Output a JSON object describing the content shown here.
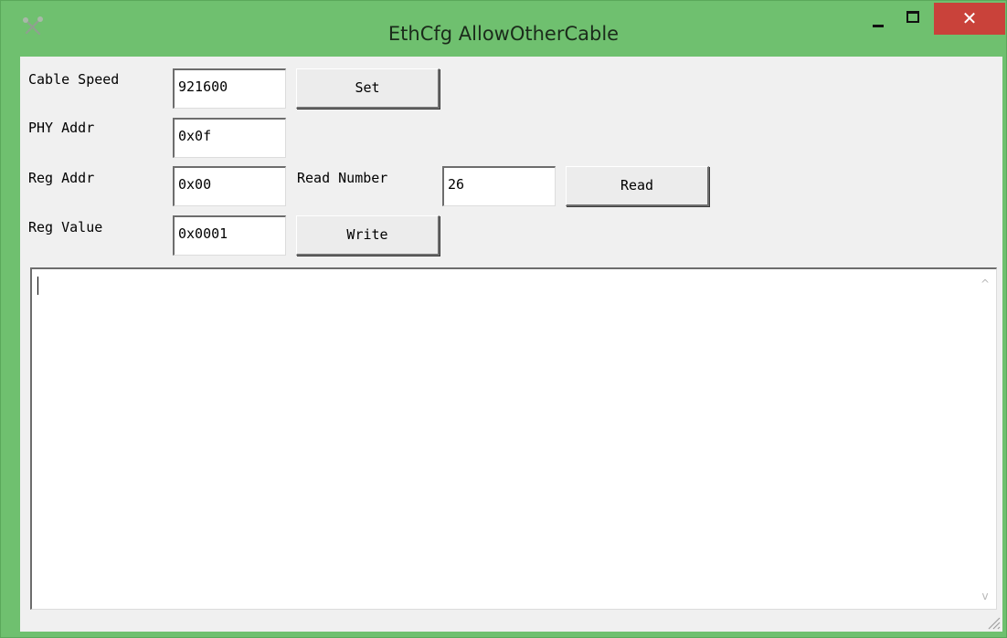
{
  "window": {
    "title": "EthCfg AllowOtherCable",
    "close_glyph": "✕",
    "icon": "tools-icon"
  },
  "form": {
    "cable_speed_label": "Cable Speed",
    "cable_speed_value": "921600",
    "set_button": "Set",
    "phy_addr_label": "PHY Addr",
    "phy_addr_value": "0x0f",
    "reg_addr_label": "Reg Addr",
    "reg_addr_value": "0x00",
    "read_number_label": "Read Number",
    "read_number_value": "26",
    "read_button": "Read",
    "reg_value_label": "Reg Value",
    "reg_value_value": "0x0001",
    "write_button": "Write"
  },
  "output": {
    "text": "",
    "scroll_up_glyph": "^",
    "scroll_down_glyph": "v"
  }
}
